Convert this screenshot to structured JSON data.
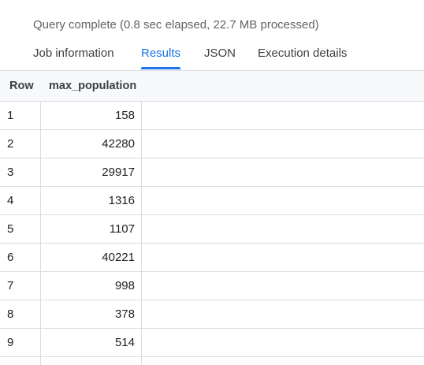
{
  "status": {
    "text": "Query complete (0.8 sec elapsed, 22.7 MB processed)"
  },
  "tabs": [
    {
      "label": "Job information",
      "active": false
    },
    {
      "label": "Results",
      "active": true
    },
    {
      "label": "JSON",
      "active": false
    },
    {
      "label": "Execution details",
      "active": false
    }
  ],
  "table": {
    "columns": [
      "Row",
      "max_population"
    ],
    "rows": [
      {
        "row": "1",
        "max_population": "158"
      },
      {
        "row": "2",
        "max_population": "42280"
      },
      {
        "row": "3",
        "max_population": "29917"
      },
      {
        "row": "4",
        "max_population": "1316"
      },
      {
        "row": "5",
        "max_population": "1107"
      },
      {
        "row": "6",
        "max_population": "40221"
      },
      {
        "row": "7",
        "max_population": "998"
      },
      {
        "row": "8",
        "max_population": "378"
      },
      {
        "row": "9",
        "max_population": "514"
      }
    ]
  },
  "colors": {
    "accent": "#1a73e8",
    "border": "#dadce0",
    "header_bg": "#f8f9fa"
  }
}
